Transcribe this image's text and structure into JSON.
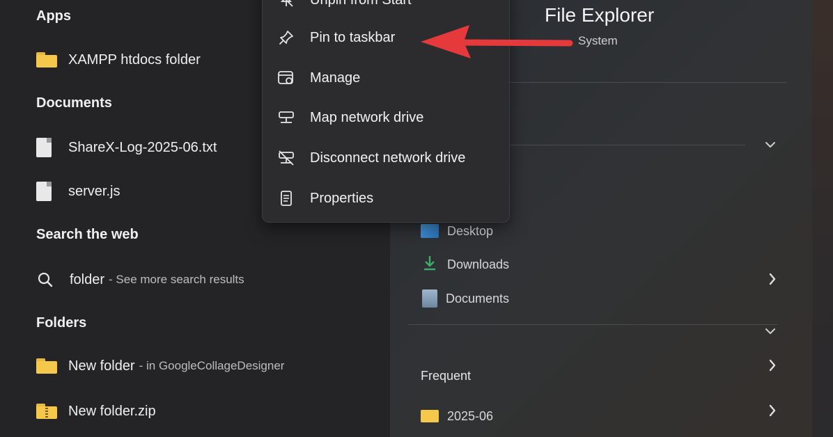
{
  "start_menu": {
    "sections": {
      "apps": "Apps",
      "documents": "Documents",
      "search_web": "Search the web",
      "folders": "Folders"
    },
    "apps": [
      {
        "label": "XAMPP htdocs folder",
        "icon": "folder-icon"
      }
    ],
    "documents": [
      {
        "label": "ShareX-Log-2025-06.txt",
        "icon": "document-icon"
      },
      {
        "label": "server.js",
        "icon": "document-icon"
      }
    ],
    "web_search": {
      "label": "folder",
      "sub": "- See more search results",
      "icon": "search-icon"
    },
    "folders": [
      {
        "label": "New folder",
        "sub": "- in GoogleCollageDesigner",
        "icon": "folder-icon"
      },
      {
        "label": "New folder.zip",
        "sub": "",
        "icon": "zip-folder-icon"
      }
    ]
  },
  "context_menu": {
    "items": [
      {
        "label": "Unpin from Start",
        "icon": "unpin-icon"
      },
      {
        "label": "Pin to taskbar",
        "icon": "pin-icon"
      },
      {
        "label": "Manage",
        "icon": "manage-icon"
      },
      {
        "label": "Map network drive",
        "icon": "map-network-drive-icon"
      },
      {
        "label": "Disconnect network drive",
        "icon": "disconnect-network-drive-icon"
      },
      {
        "label": "Properties",
        "icon": "properties-icon"
      }
    ]
  },
  "file_explorer": {
    "title": "File Explorer",
    "subtitle": "System",
    "quick_links": [
      {
        "label": "Desktop",
        "icon": "desktop-icon"
      },
      {
        "label": "Downloads",
        "icon": "download-icon"
      },
      {
        "label": "Documents",
        "icon": "documents-icon"
      }
    ],
    "frequent_title": "Frequent",
    "frequent": [
      {
        "label": "2025-06",
        "icon": "folder-icon"
      }
    ]
  },
  "colors": {
    "arrow": "#e5393c",
    "folder": "#f5c84c",
    "accent_blue": "#3a8bd6",
    "accent_green": "#3fae6a"
  }
}
